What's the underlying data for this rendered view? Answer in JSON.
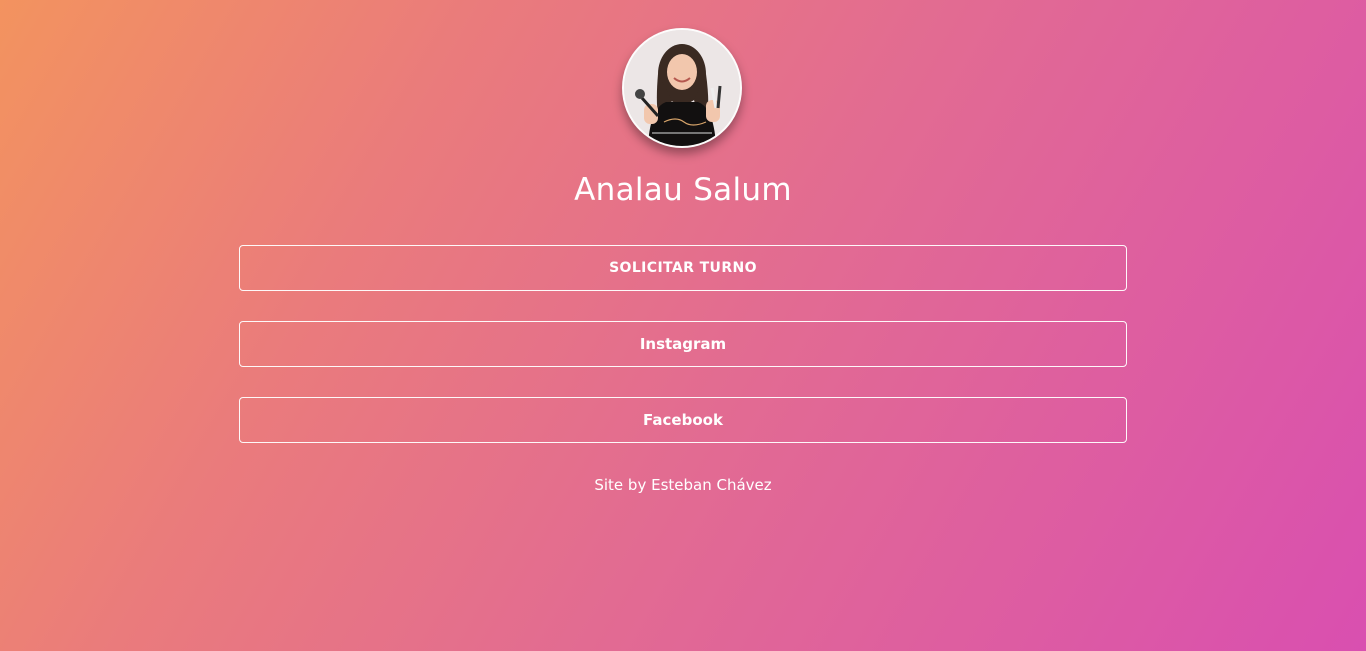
{
  "profile": {
    "name": "Analau Salum",
    "avatar_alt": "profile-photo"
  },
  "links": {
    "turno_label": "SOLICITAR TURNO",
    "instagram_label": "Instagram",
    "facebook_label": "Facebook"
  },
  "footer": {
    "credit": "Site by Esteban Chávez"
  },
  "colors": {
    "gradient_start": "#f3935f",
    "gradient_end": "#d94fb0",
    "text": "#ffffff"
  }
}
